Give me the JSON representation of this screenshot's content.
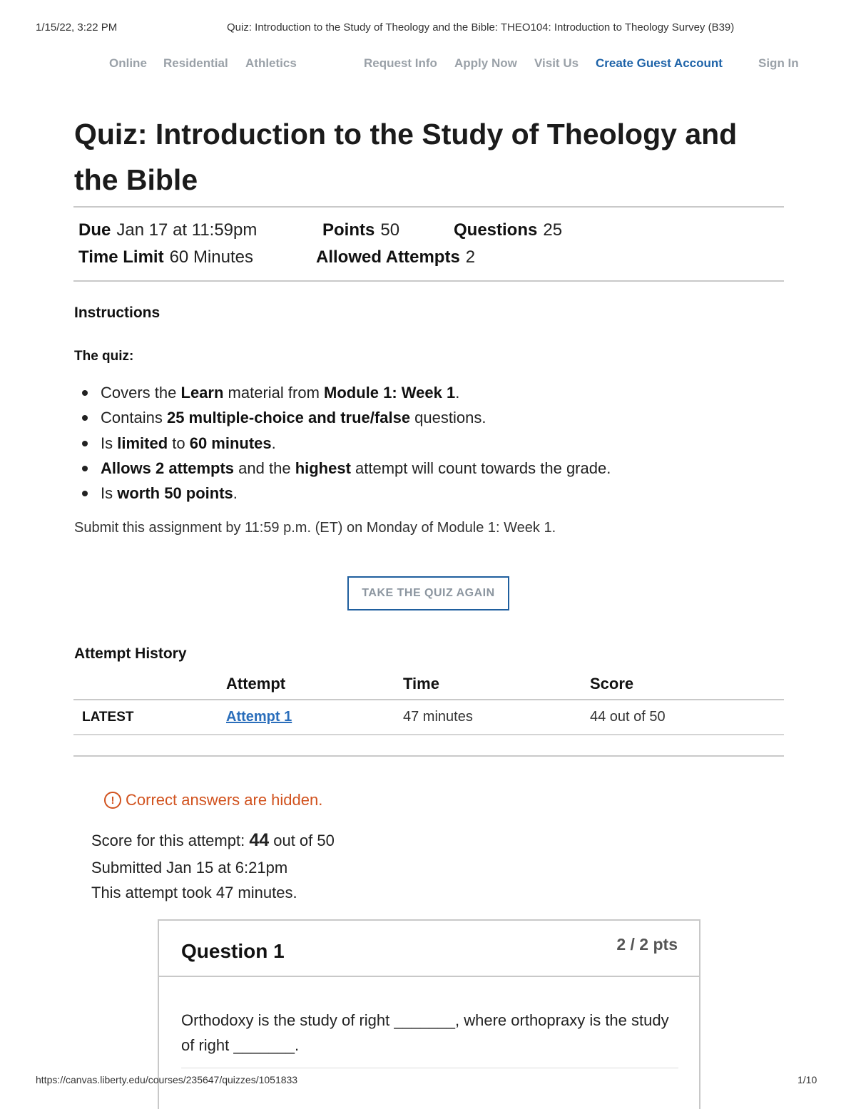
{
  "print_header": {
    "datetime": "1/15/22, 3:22 PM",
    "title": "Quiz: Introduction to the Study of Theology and the Bible: THEO104: Introduction to Theology Survey (B39)"
  },
  "print_footer": {
    "url": "https://canvas.liberty.edu/courses/235647/quizzes/1051833",
    "page": "1/10"
  },
  "top_nav": {
    "online": "Online",
    "residential": "Residential",
    "athletics": "Athletics",
    "request_info": "Request Info",
    "apply_now": "Apply Now",
    "visit_us": "Visit Us",
    "create_guest_account": "Create Guest Account",
    "sign_in": "Sign In",
    "accent_color": "#1e63a8"
  },
  "quiz": {
    "title": "Quiz: Introduction to the Study of Theology and the Bible",
    "due_label": "Due",
    "due_value": "Jan 17 at 11:59pm",
    "points_label": "Points",
    "points_value": "50",
    "questions_label": "Questions",
    "questions_value": "25",
    "time_limit_label": "Time Limit",
    "time_limit_value": "60 Minutes",
    "allowed_attempts_label": "Allowed Attempts",
    "allowed_attempts_value": "2"
  },
  "instructions": {
    "heading": "Instructions",
    "intro": "The quiz:",
    "items": [
      [
        {
          "t": "Covers the "
        },
        {
          "t": "Learn",
          "b": true
        },
        {
          "t": " material from "
        },
        {
          "t": "Module 1: Week 1",
          "b": true
        },
        {
          "t": "."
        }
      ],
      [
        {
          "t": "Contains "
        },
        {
          "t": "25 multiple-choice and true/false",
          "b": true
        },
        {
          "t": " questions."
        }
      ],
      [
        {
          "t": "Is "
        },
        {
          "t": "limited",
          "b": true
        },
        {
          "t": " to "
        },
        {
          "t": "60 minutes",
          "b": true
        },
        {
          "t": "."
        }
      ],
      [
        {
          "t": "Allows 2 attempts",
          "b": true
        },
        {
          "t": " and the "
        },
        {
          "t": "highest",
          "b": true
        },
        {
          "t": " attempt will count towards the grade."
        }
      ],
      [
        {
          "t": "Is "
        },
        {
          "t": "worth 50 points",
          "b": true
        },
        {
          "t": "."
        }
      ]
    ],
    "submit_note": "Submit this assignment by 11:59 p.m. (ET) on Monday of Module 1: Week 1."
  },
  "take_quiz_button": "TAKE THE QUIZ AGAIN",
  "attempt_history": {
    "heading": "Attempt History",
    "columns": [
      "Attempt",
      "Time",
      "Score"
    ],
    "rows": [
      {
        "label": "LATEST",
        "attempt": "Attempt 1",
        "time": "47 minutes",
        "score": "44 out of 50"
      }
    ]
  },
  "attempt_summary": {
    "hidden_notice": "Correct answers are hidden.",
    "score_prefix": "Score for this attempt: ",
    "score_value": "44",
    "score_suffix": " out of 50",
    "submitted": "Submitted Jan 15 at 6:21pm",
    "duration": "This attempt took 47 minutes.",
    "notice_color": "#d1521e"
  },
  "question_1": {
    "title": "Question 1",
    "points": "2 / 2 pts",
    "text": "Orthodoxy is the study of right _______, where orthopraxy is the study of right _______."
  }
}
